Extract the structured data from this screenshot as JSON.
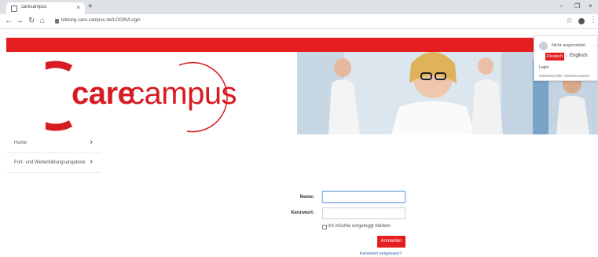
{
  "browser": {
    "tab_title": "carecampus",
    "tab_close": "×",
    "new_tab": "+",
    "url": "bildung.care-campus.de/LOGIN/Login",
    "window_controls": {
      "minimize": "–",
      "restore": "❐",
      "close": "×"
    },
    "icons": [
      "back-icon",
      "forward-icon",
      "reload-icon",
      "home-icon",
      "lock-icon",
      "star-icon",
      "account-icon",
      "menu-icon"
    ]
  },
  "site": {
    "logo": {
      "word1": "care",
      "word2": "campus"
    },
    "brand_color": "#e41e1e",
    "menu": [
      {
        "label": "Home",
        "chevron": "›"
      },
      {
        "label": "Fort- und Weiterbildungsangebote",
        "chevron": "›"
      }
    ],
    "user_panel": {
      "status": "Nicht angemeldet",
      "caret": "...",
      "lang_active": "Deutsch",
      "lang_sep": "|",
      "lang_other": "Englisch",
      "login": "Login",
      "version": "Mitarbeiterhilfe: 0030001410024"
    }
  },
  "login_form": {
    "name_label": "Name:",
    "name_value": "",
    "password_label": "Kennwort:",
    "password_value": "",
    "stay_logged_in": "Ich möchte eingeloggt bleiben",
    "submit": "Anmelden",
    "forgot": "Kennwort vergessen?"
  }
}
